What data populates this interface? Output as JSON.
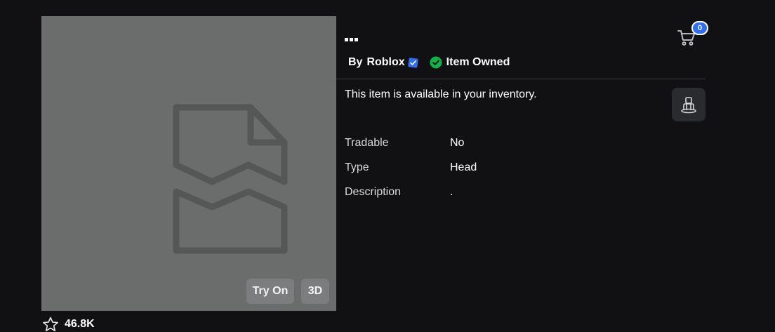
{
  "item": {
    "title_glyph": "placeholder-squares",
    "creator_prefix": "By",
    "creator_name": "Roblox",
    "owned_label": "Item Owned",
    "notice": "This item is available in your inventory."
  },
  "preview": {
    "try_on_label": "Try On",
    "three_d_label": "3D"
  },
  "favorites": {
    "count": "46.8K"
  },
  "cart": {
    "count": "0"
  },
  "details": [
    {
      "key": "Tradable",
      "value": "No"
    },
    {
      "key": "Type",
      "value": "Head"
    },
    {
      "key": "Description",
      "value": "."
    }
  ],
  "colors": {
    "background": "#111113",
    "thumbnail": "#6b6c6c",
    "verified": "#2f6ff4",
    "owned": "#10b24a",
    "cart_badge": "#2f6ff4"
  }
}
